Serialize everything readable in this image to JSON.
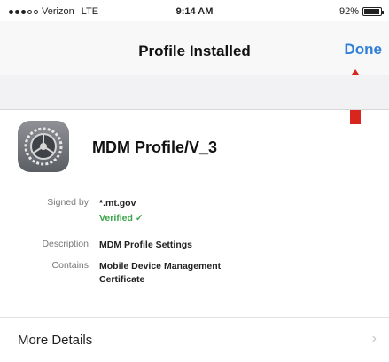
{
  "status_bar": {
    "carrier": "Verizon",
    "network": "LTE",
    "time": "9:14 AM",
    "battery": "92%",
    "signal_bars": 3,
    "battery_level": 0.92
  },
  "nav": {
    "title": "Profile Installed",
    "done_label": "Done"
  },
  "profile": {
    "name": "MDM Profile/V_3",
    "icon": "settings-gear-icon"
  },
  "details": {
    "signed_by_label": "Signed by",
    "signed_by_value": "*.mt.gov",
    "verified_label": "Verified",
    "description_label": "Description",
    "description_value": "MDM Profile Settings",
    "contains_label": "Contains",
    "contains_value_line1": "Mobile Device Management",
    "contains_value_line2": "Certificate"
  },
  "more_details": {
    "label": "More Details",
    "chevron": "chevron-right-icon"
  },
  "annotation": {
    "arrow": "red-up-arrow-icon",
    "color": "#d8261e"
  },
  "colors": {
    "accent": "#2f7fd8",
    "verified": "#3aa34a"
  }
}
